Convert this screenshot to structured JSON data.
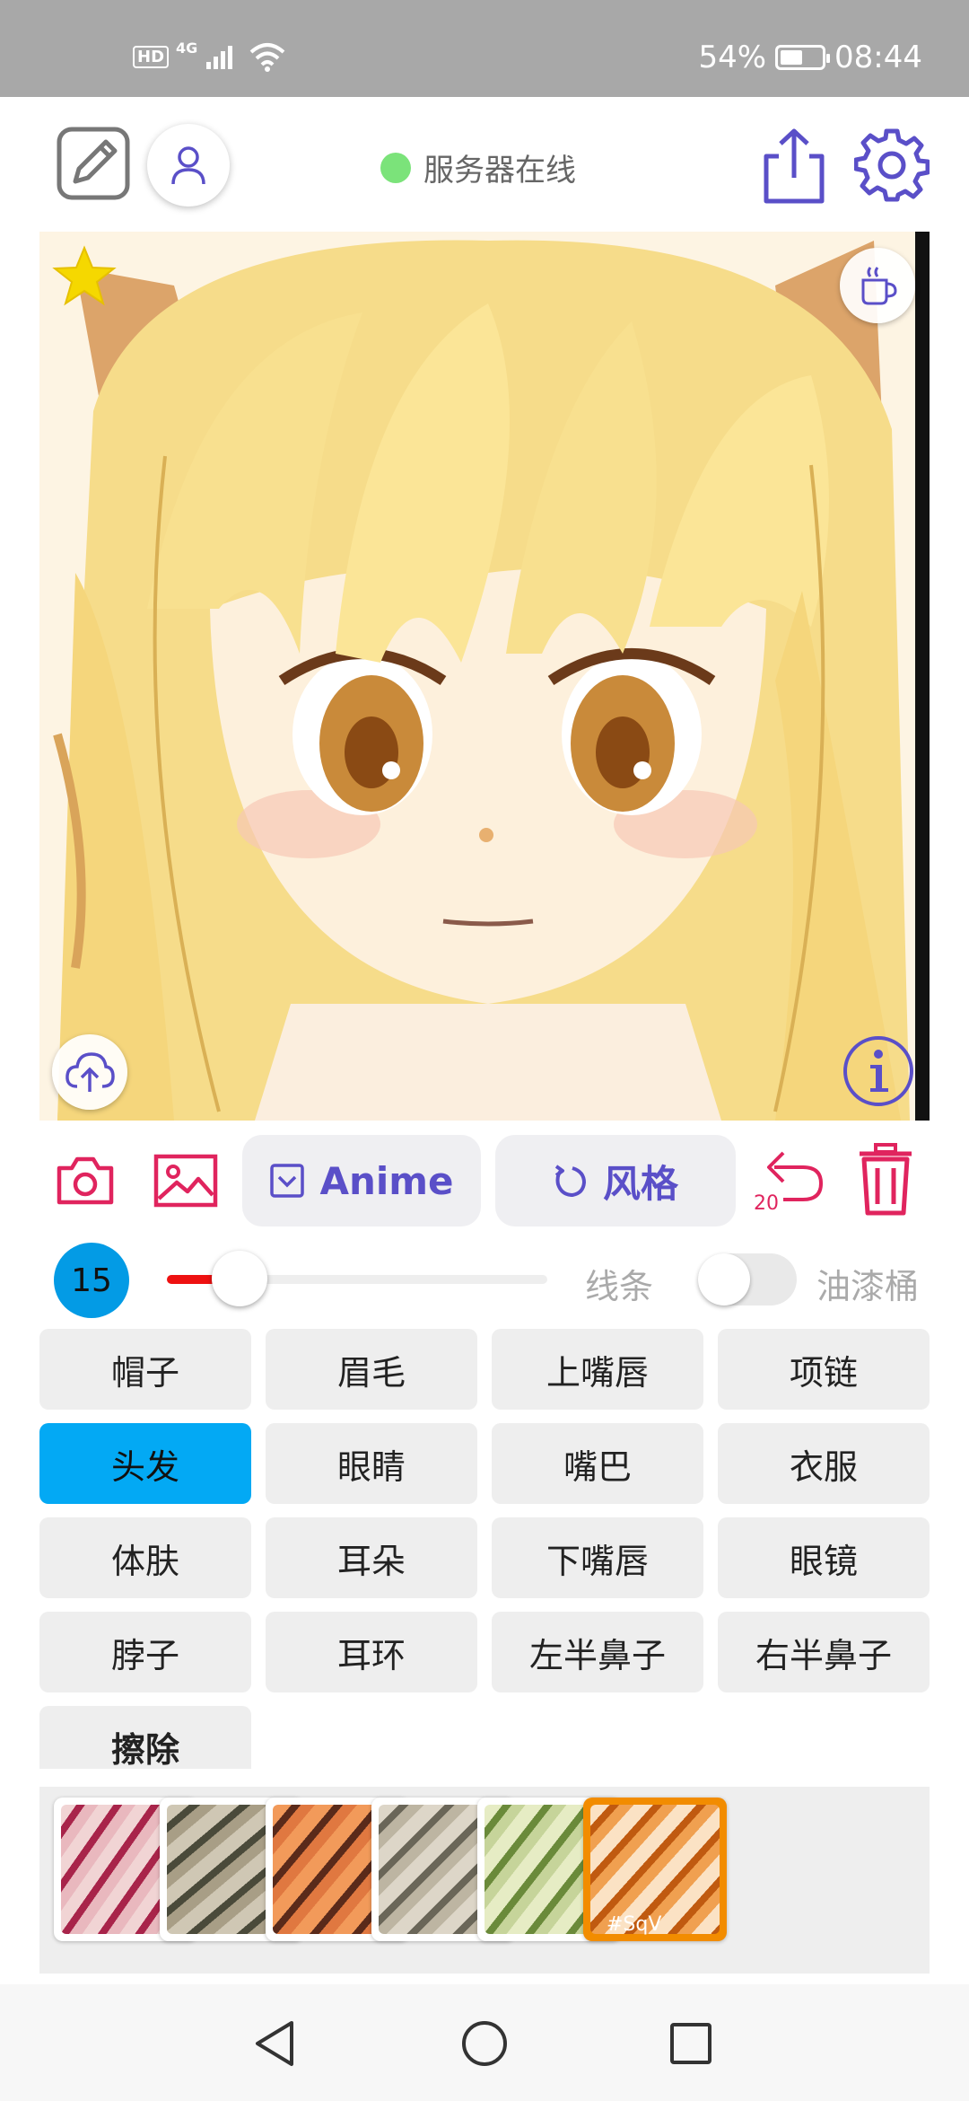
{
  "status_bar": {
    "hd_label": "HD",
    "network_label": "4G",
    "battery_percent": "54%",
    "battery_level": 0.54,
    "time": "08:44"
  },
  "header": {
    "server_status": "服务器在线",
    "server_status_color": "#7be37a",
    "icons": [
      "edit-icon",
      "user-icon",
      "share-icon",
      "settings-icon"
    ]
  },
  "canvas": {
    "overlay_icons": [
      "star-icon",
      "coffee-icon",
      "upload-cloud-icon",
      "info-icon"
    ]
  },
  "toolbar": {
    "model_label": "Anime",
    "style_label": "风格",
    "undo_count": "20",
    "icons": [
      "camera-icon",
      "gallery-icon",
      "checkbox-icon",
      "refresh-icon",
      "undo-icon",
      "trash-icon"
    ]
  },
  "brush": {
    "size": "15",
    "slider_level": 0.19,
    "line_label": "线条",
    "bucket_label": "油漆桶",
    "bucket_enabled": false
  },
  "parts": {
    "selected": "头发",
    "labels": [
      "帽子",
      "眉毛",
      "上嘴唇",
      "项链",
      "头发",
      "眼睛",
      "嘴巴",
      "衣服",
      "体肤",
      "耳朵",
      "下嘴唇",
      "眼镜",
      "脖子",
      "耳环",
      "左半鼻子",
      "右半鼻子",
      "擦除"
    ]
  },
  "style_strip": {
    "selected_tag": "#SqV"
  },
  "colors": {
    "accent": "#5a4fc8",
    "danger": "#e0245e",
    "selection": "#03a9f4",
    "slider_fill": "#ee1111"
  },
  "nav_bar": {
    "icons": [
      "back-icon",
      "home-icon",
      "recents-icon"
    ]
  }
}
